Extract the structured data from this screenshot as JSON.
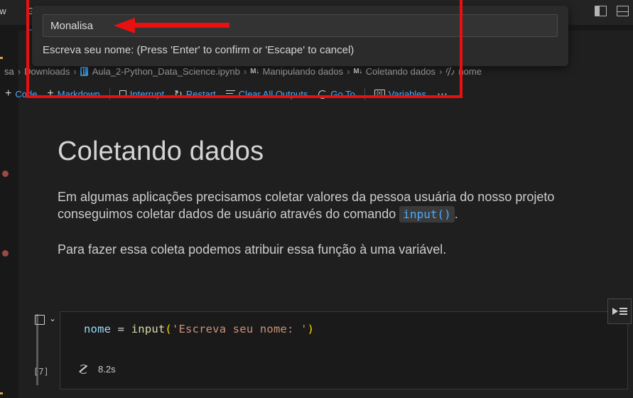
{
  "menubar": {
    "items": [
      {
        "label": "ew",
        "name": "menu-view"
      },
      {
        "label": "G",
        "name": "menu-go"
      }
    ],
    "window_icons": [
      {
        "name": "layout-sidebar-icon"
      },
      {
        "name": "layout-panel-icon"
      }
    ]
  },
  "quick_input": {
    "value": "Monalisa",
    "placeholder": "Escreva seu nome:",
    "description": "Escreva seu nome: (Press 'Enter' to confirm or 'Escape' to cancel)"
  },
  "breadcrumb": {
    "segments": [
      {
        "label": "sa",
        "icon": null
      },
      {
        "label": "Downloads",
        "icon": null
      },
      {
        "label": "Aula_2-Python_Data_Science.ipynb",
        "icon": "notebook-icon"
      },
      {
        "label": "Manipulando dados",
        "icon": "markdown-icon"
      },
      {
        "label": "Coletando dados",
        "icon": "markdown-icon"
      },
      {
        "label": "nome",
        "icon": "sync-icon"
      }
    ],
    "separator": "›"
  },
  "notebook_toolbar": {
    "buttons": [
      {
        "label": "Code",
        "icon": "plus-icon",
        "name": "add-code-cell-button"
      },
      {
        "label": "Markdown",
        "icon": "plus-icon",
        "name": "add-markdown-cell-button"
      },
      {
        "label": "Interrupt",
        "icon": "stop-icon",
        "name": "interrupt-button"
      },
      {
        "label": "Restart",
        "icon": "restart-icon",
        "name": "restart-button"
      },
      {
        "label": "Clear All Outputs",
        "icon": "clear-outputs-icon",
        "name": "clear-all-outputs-button"
      },
      {
        "label": "Go To",
        "icon": "goto-icon",
        "name": "go-to-button"
      },
      {
        "label": "Variables",
        "icon": "variables-icon",
        "name": "variables-button"
      }
    ],
    "more_label": "⋯"
  },
  "notebook": {
    "heading": "Coletando dados",
    "paragraph1": {
      "before": "Em algumas aplicações precisamos coletar valores da pessoa usuária do nosso projeto",
      "line2_before": "conseguimos coletar dados de usuário através do comando ",
      "code": "input()",
      "after": "."
    },
    "paragraph2": "Para fazer essa coleta podemos atribuir essa função à uma variável.",
    "cell": {
      "execution_count": "[7]",
      "code_tokens": [
        {
          "text": "nome",
          "type": "variable"
        },
        {
          "text": " = ",
          "type": "operator"
        },
        {
          "text": "input",
          "type": "function"
        },
        {
          "text": "(",
          "type": "paren"
        },
        {
          "text": "'Escreva seu nome: '",
          "type": "string"
        },
        {
          "text": ")",
          "type": "paren"
        }
      ],
      "code_plain": "nome = input('Escreva seu nome: ')",
      "run_time": "8.2s",
      "status_icon": "running-sync-icon"
    }
  },
  "run_by_line": {
    "name": "run-by-line-button"
  },
  "annotations": {
    "rectangle_color": "#e81010",
    "arrow_color": "#e81010"
  },
  "colors": {
    "background": "#1f1f1f",
    "panel": "#181818",
    "accent_blue": "#4daafc",
    "code_variable": "#9cdcfe",
    "code_function": "#dcdcaa",
    "code_string": "#ce9178",
    "code_paren": "#ffd700",
    "annotation_red": "#e81010"
  }
}
